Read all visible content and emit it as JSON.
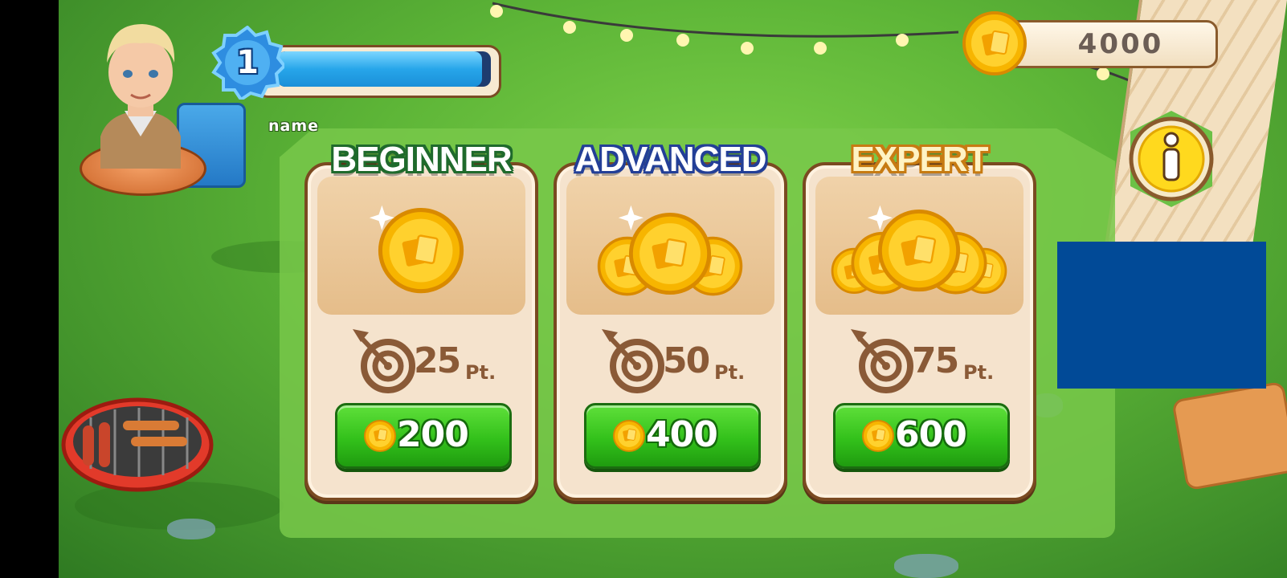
{
  "player": {
    "level": "1",
    "name": "name",
    "xp_fraction": 0.96
  },
  "currency": {
    "amount": "4000",
    "icon": "coin-icon"
  },
  "info_button": {
    "icon": "info-icon"
  },
  "tiers": [
    {
      "id": "beginner",
      "label": "BEGINNER",
      "points": "25",
      "points_unit": "Pt.",
      "price": "200",
      "coin_count": 1,
      "label_color": "#ffffff",
      "label_outline": "#1f6a2c"
    },
    {
      "id": "advanced",
      "label": "ADVANCED",
      "points": "50",
      "points_unit": "Pt.",
      "price": "400",
      "coin_count": 3,
      "label_color": "#ffffff",
      "label_outline": "#233f97"
    },
    {
      "id": "expert",
      "label": "EXPERT",
      "points": "75",
      "points_unit": "Pt.",
      "price": "600",
      "coin_count": 5,
      "label_color": "#fff3c4",
      "label_outline": "#c77b12"
    }
  ],
  "colors": {
    "grass": "#5db537",
    "card": "#f5e3cd",
    "button_green": "#33c11b",
    "xp_blue": "#27a6ea",
    "ad_block": "#014a97"
  }
}
